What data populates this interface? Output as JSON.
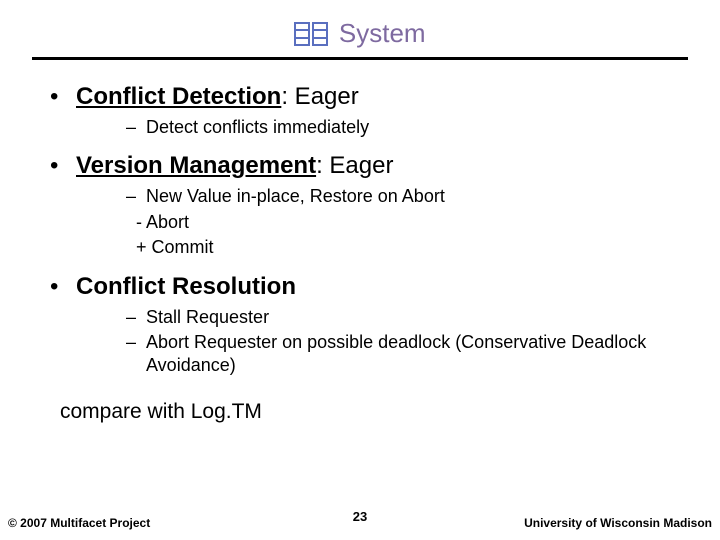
{
  "title": "System",
  "bullets": [
    {
      "strong": "Conflict Detection",
      "rest": ": Eager",
      "sub": [
        {
          "style": "dash",
          "text": "Detect conflicts immediately"
        }
      ]
    },
    {
      "strong": "Version Management",
      "rest": ": Eager",
      "sub": [
        {
          "style": "dash",
          "text": "New Value in-place, Restore on Abort"
        },
        {
          "style": "nodash",
          "text": "- Abort"
        },
        {
          "style": "nodash",
          "text": "+ Commit"
        }
      ]
    },
    {
      "strong": "Conflict Resolution",
      "rest": "",
      "sub": [
        {
          "style": "dash",
          "text": "Stall Requester"
        },
        {
          "style": "dash",
          "text": "Abort Requester on possible deadlock (Conservative Deadlock Avoidance)"
        }
      ]
    }
  ],
  "compare": "compare with Log.TM",
  "footer": {
    "left": "© 2007 Multifacet Project",
    "page": "23",
    "right": "University of Wisconsin Madison"
  }
}
